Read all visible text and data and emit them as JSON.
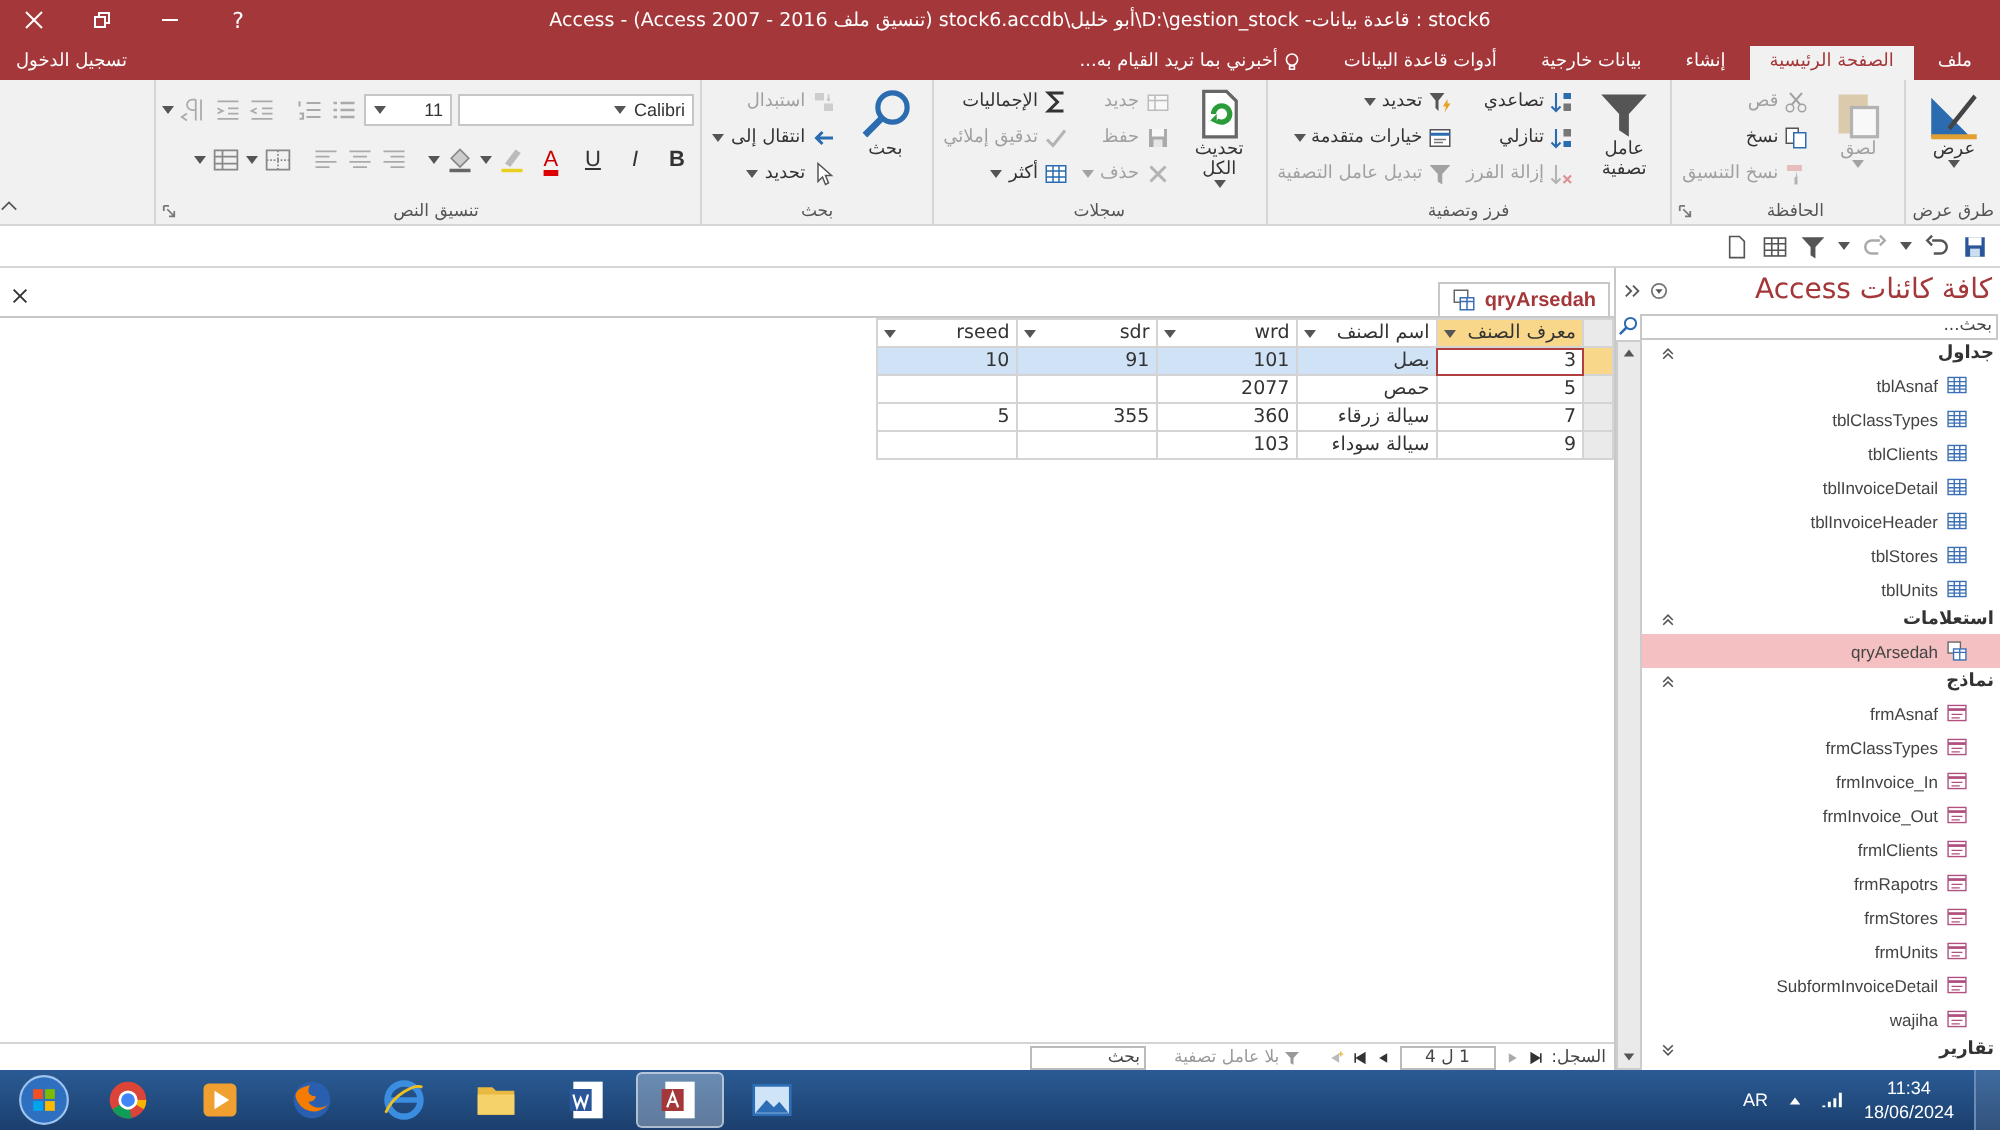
{
  "window": {
    "title": "stock6 : قاعدة بيانات- D:\\gestion_stock\\أبو خليل\\stock6.accdb (تنسيق ملف Access 2007 - 2016) - Access",
    "help": "?"
  },
  "ribbon_tabs": [
    {
      "label": "ملف",
      "selected": false
    },
    {
      "label": "الصفحة الرئيسية",
      "selected": true
    },
    {
      "label": "إنشاء",
      "selected": false
    },
    {
      "label": "بيانات خارجية",
      "selected": false
    },
    {
      "label": "أدوات قاعدة البيانات",
      "selected": false
    }
  ],
  "tell_me": {
    "placeholder": "أخبرني بما تريد القيام به..."
  },
  "sign_in": "تسجيل الدخول",
  "ribbon_groups": [
    {
      "title": "طرق عرض",
      "launcher": false,
      "commands": [
        {
          "label": "عرض",
          "kind": "view",
          "disabled": false,
          "dropdown": true
        }
      ]
    },
    {
      "title": "الحافظة",
      "launcher": true,
      "commands": [
        {
          "label": "لصق",
          "kind": "paste",
          "disabled": true,
          "dropdown": true
        },
        {
          "label": "قص",
          "kind": "cut",
          "disabled": true,
          "dropdown": false
        },
        {
          "label": "نسخ",
          "kind": "copy",
          "disabled": false,
          "dropdown": false
        },
        {
          "label": "نسخ التنسيق",
          "kind": "format-painter",
          "disabled": true,
          "dropdown": false
        }
      ]
    },
    {
      "title": "فرز وتصفية",
      "launcher": false,
      "commands": [
        {
          "label": "عامل تصفية",
          "kind": "filter",
          "disabled": false,
          "dropdown": false
        },
        {
          "label": "تصاعدي",
          "kind": "sort-ascending",
          "disabled": false,
          "dropdown": false
        },
        {
          "label": "تنازلي",
          "kind": "sort-descending",
          "disabled": false,
          "dropdown": false
        },
        {
          "label": "إزالة الفرز",
          "kind": "remove-sort",
          "disabled": true,
          "dropdown": false
        },
        {
          "label": "تحديد",
          "kind": "selection-filter",
          "disabled": false,
          "dropdown": true
        },
        {
          "label": "خيارات متقدمة",
          "kind": "form-window",
          "disabled": false,
          "dropdown": true
        },
        {
          "label": "تبديل عامل التصفية",
          "kind": "toggle-filter",
          "disabled": true,
          "dropdown": false
        }
      ]
    },
    {
      "title": "سجلات",
      "launcher": false,
      "commands": [
        {
          "label": "تحديث الكل",
          "kind": "refresh",
          "disabled": false,
          "dropdown": true
        },
        {
          "label": "جديد",
          "kind": "new-record",
          "disabled": true,
          "dropdown": false
        },
        {
          "label": "حفظ",
          "kind": "save",
          "disabled": true,
          "dropdown": false
        },
        {
          "label": "حذف",
          "kind": "delete",
          "disabled": true,
          "dropdown": true
        },
        {
          "label": "الإجماليات",
          "kind": "sigma",
          "disabled": false,
          "dropdown": false
        },
        {
          "label": "تدقيق إملائي",
          "kind": "spelling",
          "disabled": true,
          "dropdown": false
        },
        {
          "label": "أكثر",
          "kind": "grid",
          "disabled": false,
          "dropdown": true
        }
      ]
    },
    {
      "title": "بحث",
      "launcher": false,
      "commands": [
        {
          "label": "بحث",
          "kind": "search",
          "disabled": false,
          "dropdown": false
        },
        {
          "label": "استبدال",
          "kind": "replace",
          "disabled": true,
          "dropdown": false
        },
        {
          "label": "انتقال إلى",
          "kind": "arrow",
          "disabled": false,
          "dropdown": true
        },
        {
          "label": "تحديد",
          "kind": "cursor",
          "disabled": false,
          "dropdown": true
        }
      ]
    }
  ],
  "text_format": {
    "title": "تنسيق النص",
    "launcher": true,
    "font": "Calibri",
    "size": "11",
    "style_buttons": [
      {
        "label": "B",
        "kind": "bold"
      },
      {
        "label": "I",
        "kind": "italic"
      },
      {
        "label": "U",
        "kind": "underline"
      },
      {
        "label": "A",
        "kind": "font-color"
      }
    ]
  },
  "document_tab": {
    "label": "qryArsedah"
  },
  "datasheet": {
    "columns": [
      {
        "label": "معرف الصنف",
        "selected": true
      },
      {
        "label": "اسم الصنف",
        "selected": false
      },
      {
        "label": "wrd",
        "selected": false
      },
      {
        "label": "sdr",
        "selected": false
      },
      {
        "label": "rseed",
        "selected": false
      }
    ],
    "rows": [
      {
        "cells": [
          "3",
          "بصل",
          "101",
          "91",
          "10"
        ],
        "selected": true
      },
      {
        "cells": [
          "5",
          "حمص",
          "2077",
          null,
          null
        ],
        "selected": false
      },
      {
        "cells": [
          "7",
          "سيالة زرقاء",
          "360",
          "355",
          "5"
        ],
        "selected": false
      },
      {
        "cells": [
          "9",
          "سيالة سوداء",
          "103",
          null,
          null
        ],
        "selected": false
      }
    ]
  },
  "record_navigation": {
    "label": "السجل:",
    "position": "1 ل 4",
    "filter": "بلا عامل تصفية",
    "search": {
      "placeholder": "بحث"
    }
  },
  "navigation_pane": {
    "title": "كافة كائنات Access",
    "search": {
      "placeholder": "بحث..."
    },
    "groups": [
      {
        "title": "جداول",
        "expanded": true,
        "items": [
          {
            "label": "tblAsnaf",
            "kind": "table",
            "selected": false
          },
          {
            "label": "tblClassTypes",
            "kind": "table",
            "selected": false
          },
          {
            "label": "tblClients",
            "kind": "table",
            "selected": false
          },
          {
            "label": "tblInvoiceDetail",
            "kind": "table",
            "selected": false
          },
          {
            "label": "tblInvoiceHeader",
            "kind": "table",
            "selected": false
          },
          {
            "label": "tblStores",
            "kind": "table",
            "selected": false
          },
          {
            "label": "tblUnits",
            "kind": "table",
            "selected": false
          }
        ]
      },
      {
        "title": "استعلامات",
        "expanded": true,
        "items": [
          {
            "label": "qryArsedah",
            "kind": "query",
            "selected": true
          }
        ]
      },
      {
        "title": "نماذج",
        "expanded": true,
        "items": [
          {
            "label": "frmAsnaf",
            "kind": "form",
            "selected": false
          },
          {
            "label": "frmClassTypes",
            "kind": "form",
            "selected": false
          },
          {
            "label": "frmInvoice_In",
            "kind": "form",
            "selected": false
          },
          {
            "label": "frmInvoice_Out",
            "kind": "form",
            "selected": false
          },
          {
            "label": "frmlClients",
            "kind": "form",
            "selected": false
          },
          {
            "label": "frmRapotrs",
            "kind": "form",
            "selected": false
          },
          {
            "label": "frmStores",
            "kind": "form",
            "selected": false
          },
          {
            "label": "frmUnits",
            "kind": "form",
            "selected": false
          },
          {
            "label": "SubformInvoiceDetail",
            "kind": "form",
            "selected": false
          },
          {
            "label": "wajiha",
            "kind": "form",
            "selected": false
          }
        ]
      },
      {
        "title": "تقارير",
        "expanded": false
      }
    ]
  },
  "taskbar": {
    "apps": [
      {
        "kind": "round-browser",
        "active": false
      },
      {
        "kind": "media-player",
        "active": false
      },
      {
        "kind": "fox-browser",
        "active": false
      },
      {
        "kind": "e-browser",
        "active": false
      },
      {
        "kind": "folder",
        "active": false
      },
      {
        "kind": "word-document",
        "active": false
      },
      {
        "kind": "database",
        "active": true
      },
      {
        "kind": "picture",
        "active": false
      }
    ],
    "language": "AR",
    "time": "11:34",
    "date": "18/06/2024"
  }
}
